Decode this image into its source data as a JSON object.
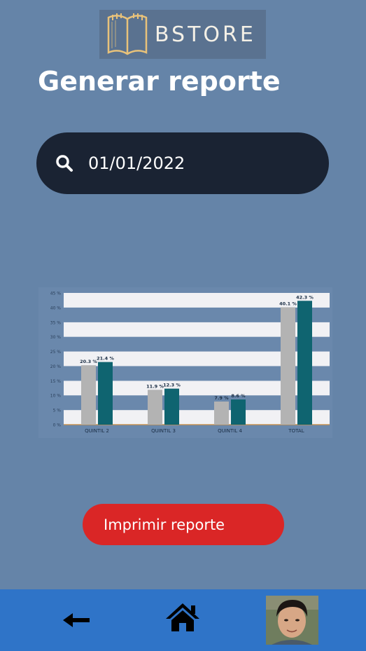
{
  "app": {
    "logo_text": "BSTORE"
  },
  "page": {
    "title": "Generar reporte"
  },
  "search": {
    "value": "01/01/2022"
  },
  "chart_data": {
    "type": "bar",
    "categories": [
      "QUINTIL 2",
      "QUINTIL 3",
      "QUINTIL 4",
      "TOTAL"
    ],
    "series": [
      {
        "values": [
          20.3,
          11.9,
          7.9,
          40.1
        ],
        "labels": [
          "20.3 %",
          "11.9 %",
          "7.9 %",
          "40.1 %"
        ],
        "color": "#b3b3b3"
      },
      {
        "values": [
          21.4,
          12.3,
          8.6,
          42.3
        ],
        "labels": [
          "21.4 %",
          "12.3 %",
          "8.6 %",
          "42.3 %"
        ],
        "color": "#0f6470"
      }
    ],
    "yticks": [
      "0 %",
      "5 %",
      "10 %",
      "15 %",
      "20 %",
      "25 %",
      "30 %",
      "35 %",
      "40 %",
      "45 %"
    ],
    "ylim": [
      0,
      45
    ],
    "grid": true,
    "title": "",
    "xlabel": "",
    "ylabel": ""
  },
  "actions": {
    "print_label": "Imprimir reporte"
  },
  "nav": {
    "back_icon": "arrow-left-icon",
    "home_icon": "home-icon",
    "profile_icon": "avatar"
  },
  "colors": {
    "background": "#6584a8",
    "search_bg": "#1a2333",
    "print_button": "#da2626",
    "bottom_bar": "#2f74c8",
    "bar_gray": "#b3b3b3",
    "bar_teal": "#0f6470"
  }
}
